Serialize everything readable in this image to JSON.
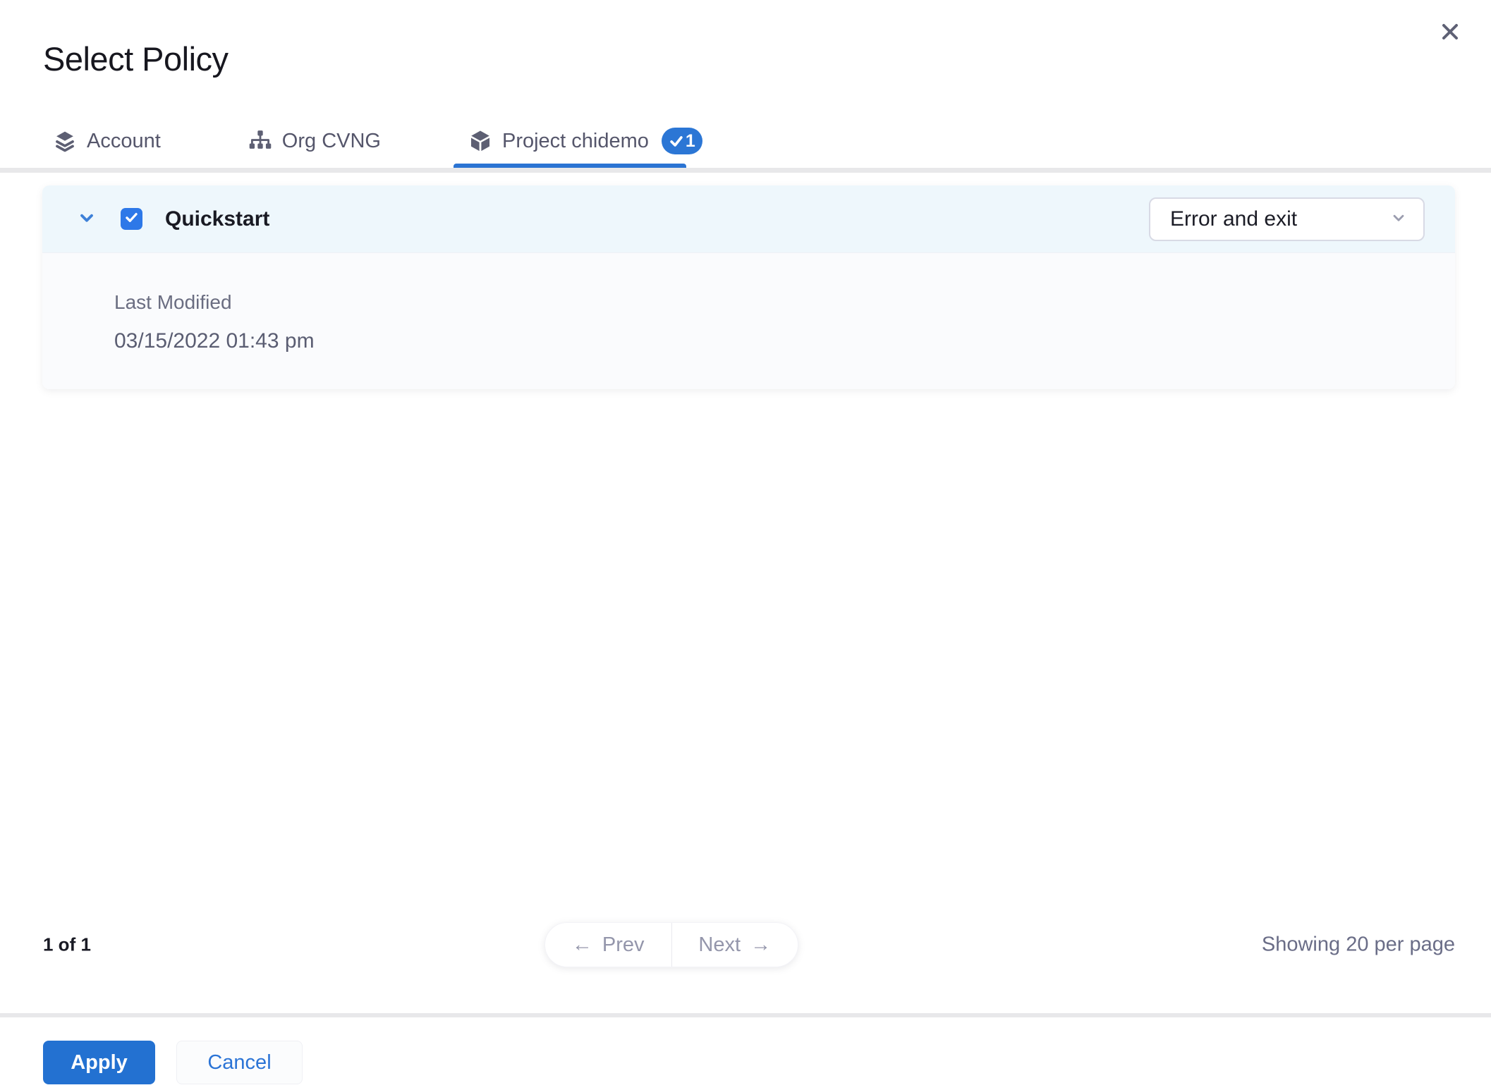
{
  "modal": {
    "title": "Select Policy"
  },
  "tabs": [
    {
      "label": "Account",
      "icon": "layers-icon",
      "active": false
    },
    {
      "label": "Org CVNG",
      "icon": "sitemap-icon",
      "active": false
    },
    {
      "label": "Project chidemo",
      "icon": "cube-icon",
      "active": true,
      "badge_count": "1"
    }
  ],
  "policy": {
    "name": "Quickstart",
    "checked": true,
    "action_select": {
      "value": "Error and exit"
    },
    "details": {
      "last_modified_label": "Last Modified",
      "last_modified_value": "03/15/2022 01:43 pm"
    }
  },
  "pagination": {
    "page_info": "1 of 1",
    "prev_arrow": "←",
    "prev_label": "Prev",
    "next_label": "Next",
    "next_arrow": "→",
    "per_page": "Showing 20 per page"
  },
  "footer": {
    "apply_label": "Apply",
    "cancel_label": "Cancel"
  },
  "colors": {
    "primary_blue": "#2b74d3",
    "checkbox_blue": "#2d78e8",
    "header_row_bg": "#eef7fc",
    "panel_body_bg": "#fafbfd",
    "divider_gray": "#e8e8ea",
    "slate_text": "#55566b",
    "muted_text": "#6a6d81"
  }
}
